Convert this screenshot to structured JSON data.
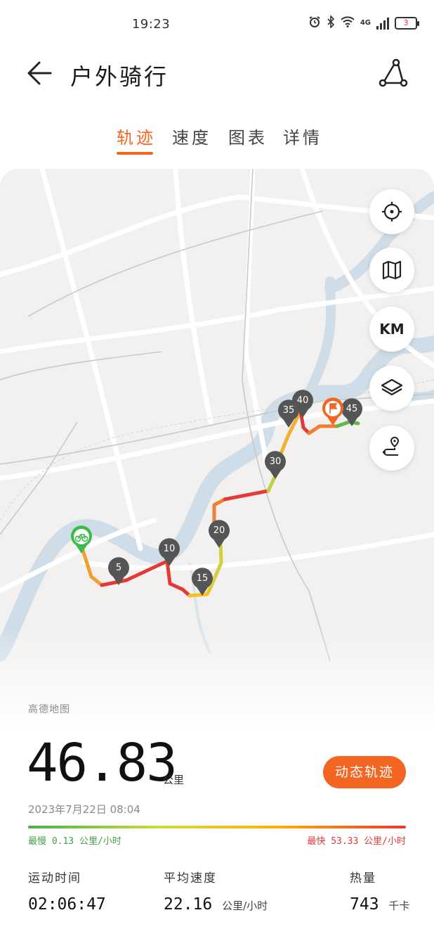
{
  "status_bar": {
    "time": "19:23",
    "network": "4G",
    "battery": "3"
  },
  "header": {
    "title": "户外骑行"
  },
  "tabs": [
    {
      "label": "轨迹",
      "active": true
    },
    {
      "label": "速度",
      "active": false
    },
    {
      "label": "图表",
      "active": false
    },
    {
      "label": "详情",
      "active": false
    }
  ],
  "map": {
    "attribution": "高德地图",
    "controls": [
      "locate-icon",
      "map-icon",
      "KM",
      "layers-icon",
      "route-icon"
    ],
    "km_label": "KM",
    "markers": [
      "5",
      "10",
      "15",
      "20",
      "30",
      "35",
      "40",
      "45"
    ]
  },
  "summary": {
    "distance": "46.83",
    "distance_unit": "公里",
    "replay_button": "动态轨迹",
    "datetime": "2023年7月22日  08:04",
    "slowest": "最慢 0.13 公里/小时",
    "fastest": "最快 53.33 公里/小时"
  },
  "stats": {
    "duration": {
      "label": "运动时间",
      "value": "02:06:47"
    },
    "avg_speed": {
      "label": "平均速度",
      "value": "22.16",
      "unit": "公里/小时"
    },
    "calories": {
      "label": "热量",
      "value": "743",
      "unit": "千卡"
    }
  },
  "colors": {
    "accent": "#f26622",
    "slow": "#43a047",
    "fast": "#e53935",
    "river": "#cfdde8"
  }
}
